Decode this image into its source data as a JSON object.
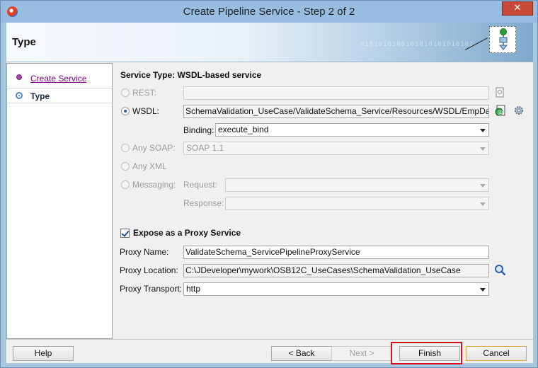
{
  "window": {
    "title": "Create Pipeline Service - Step 2 of 2",
    "close": "✕"
  },
  "header": {
    "title": "Type",
    "decoration": "0101010100101010101010101"
  },
  "nav": {
    "items": [
      {
        "label": "Create Service",
        "state": "done"
      },
      {
        "label": "Type",
        "state": "current"
      }
    ]
  },
  "section_title": "Service Type: WSDL-based service",
  "service_types": {
    "rest": {
      "label": "REST:",
      "selected": false,
      "enabled": false,
      "value": ""
    },
    "wsdl": {
      "label": "WSDL:",
      "selected": true,
      "enabled": true,
      "value": "SchemaValidation_UseCase/ValidateSchema_Service/Resources/WSDL/EmpData"
    },
    "binding": {
      "label": "Binding:",
      "value": "execute_bind"
    },
    "any_soap": {
      "label": "Any SOAP:",
      "selected": false,
      "enabled": false,
      "value": "SOAP 1.1"
    },
    "any_xml": {
      "label": "Any XML",
      "selected": false,
      "enabled": false
    },
    "messaging": {
      "label": "Messaging:",
      "selected": false,
      "enabled": false
    },
    "request": {
      "label": "Request:",
      "value": ""
    },
    "response": {
      "label": "Response:",
      "value": ""
    }
  },
  "proxy": {
    "expose_label": "Expose as a Proxy Service",
    "expose_checked": true,
    "name_label": "Proxy Name:",
    "name_value": "ValidateSchema_ServicePipelineProxyService",
    "location_label": "Proxy Location:",
    "location_value": "C:\\JDeveloper\\mywork\\OSB12C_UseCases\\SchemaValidation_UseCase",
    "transport_label": "Proxy Transport:",
    "transport_value": "http"
  },
  "footer": {
    "help": "Help",
    "back": "< Back",
    "next": "Next >",
    "finish": "Finish",
    "cancel": "Cancel"
  },
  "colors": {
    "highlight": "#d0121e",
    "title_bar": "#99bde0",
    "link": "#800080"
  }
}
